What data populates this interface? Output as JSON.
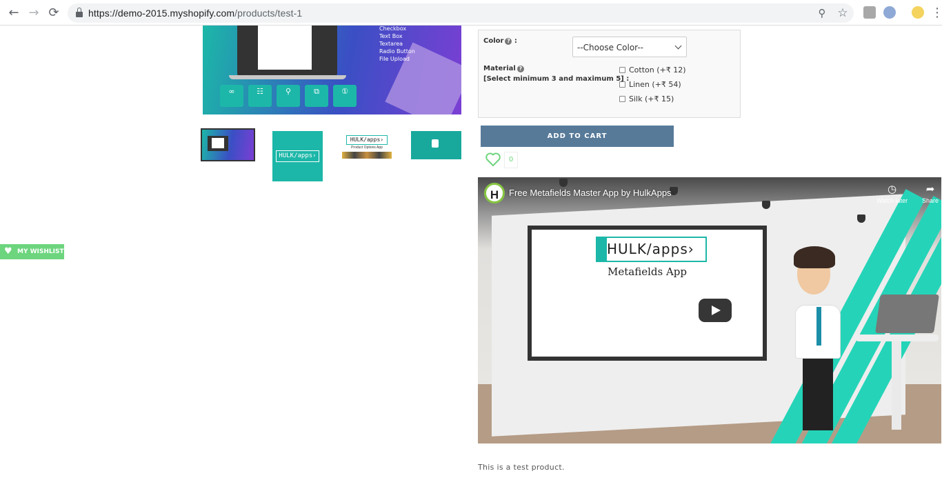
{
  "browser": {
    "back_glyph": "←",
    "forward_glyph": "→",
    "reload_glyph": "⟳",
    "url_host": "https://demo-2015.myshopify.com",
    "url_path": "/products/test-1",
    "zoom_glyph": "⚲",
    "star_glyph": "☆",
    "menu_glyph": "⋮",
    "icons": [
      "back-icon",
      "forward-icon",
      "reload-icon",
      "lock-icon",
      "zoom-icon",
      "star-icon",
      "extension-icon",
      "profile-icon",
      "menu-icon"
    ]
  },
  "gallery": {
    "feature_list": [
      "Checkbox",
      "Text Box",
      "Textarea",
      "Radio Button",
      "File Upload"
    ],
    "feature_glyphs": [
      "∞",
      "☷",
      "⚲",
      "⧉",
      "①"
    ],
    "thumbnail_count": 4,
    "thumb2_logo": "HULK/apps›",
    "thumb3_logo": "HULK/apps›",
    "thumb3_caption": "Product Options App"
  },
  "options": {
    "color_label": "Color",
    "help_glyph": "?",
    "color_suffix": " :",
    "color_select_value": "--Choose Color--",
    "material_label": "Material",
    "material_rule": "[Select minimum 3 and maximum 5] :",
    "materials": [
      {
        "label": "Cotton (+₹ 12)",
        "checked": false
      },
      {
        "label": "Linen (+₹ 54)",
        "checked": false
      },
      {
        "label": "Silk (+₹ 15)",
        "checked": false
      }
    ]
  },
  "cart": {
    "add_to_cart_label": "ADD TO CART",
    "wishlist_count": "0"
  },
  "video": {
    "channel_initial": "H",
    "title": "Free Metafields Master App by HulkApps",
    "watch_later_label": "Watch later",
    "watch_later_glyph": "◷",
    "share_label": "Share",
    "share_glyph": "➦",
    "screen_logo": "HULK/apps›",
    "screen_subtitle": "Metafields App"
  },
  "wishlist_tab": {
    "label": "MY WISHLIST",
    "glyph": "♥"
  },
  "description": "This is a test product.",
  "colors": {
    "accent_teal": "#1cb7a8",
    "cart_button": "#577a99",
    "wishlist_green": "#6dd57e"
  }
}
